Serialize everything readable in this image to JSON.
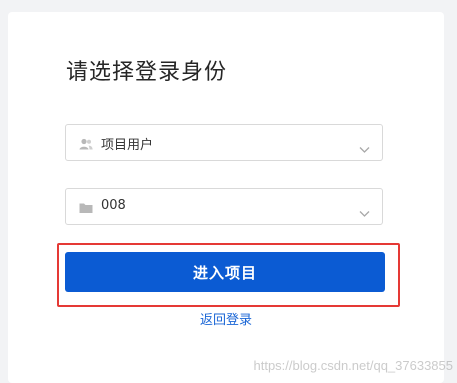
{
  "login_card": {
    "title": "请选择登录身份",
    "role_select": {
      "icon": "user-group-icon",
      "value": "项目用户"
    },
    "project_select": {
      "icon": "folder-icon",
      "value": "008"
    },
    "enter_button_label": "进入项目",
    "back_link_label": "返回登录"
  },
  "watermark": "https://blog.csdn.net/qq_37633855",
  "colors": {
    "primary": "#0b5bd3",
    "link": "#1a66d6",
    "highlight": "#e53935"
  }
}
